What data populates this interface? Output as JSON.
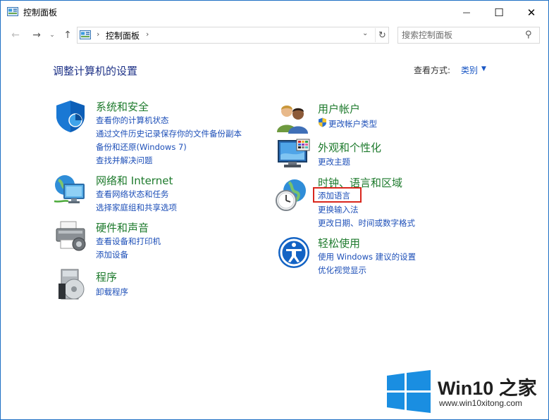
{
  "window": {
    "title": "控制面板",
    "min_glyph": "—",
    "max_glyph": "☐",
    "close_glyph": "✕"
  },
  "nav": {
    "back_glyph": "←",
    "forward_glyph": "→",
    "recent_glyph": "⌄",
    "up_glyph": "↑",
    "breadcrumb": "控制面板",
    "sep1": "›",
    "sep2": "›",
    "dropdown_glyph": "⌄",
    "refresh_glyph": "↻"
  },
  "search": {
    "placeholder": "搜索控制面板",
    "icon_glyph": "⚲"
  },
  "main": {
    "heading": "调整计算机的设置",
    "view_by_label": "查看方式:",
    "view_by_value": "类别",
    "view_by_arrow": "▼"
  },
  "categories": {
    "system_security": {
      "title": "系统和安全",
      "links": [
        "查看你的计算机状态",
        "通过文件历史记录保存你的文件备份副本",
        "备份和还原(Windows 7)",
        "查找并解决问题"
      ]
    },
    "network_internet": {
      "title": "网络和 Internet",
      "links": [
        "查看网络状态和任务",
        "选择家庭组和共享选项"
      ]
    },
    "hardware_sound": {
      "title": "硬件和声音",
      "links": [
        "查看设备和打印机",
        "添加设备"
      ]
    },
    "programs": {
      "title": "程序",
      "links": [
        "卸载程序"
      ]
    },
    "user_accounts": {
      "title": "用户帐户",
      "links": [
        "更改帐户类型"
      ]
    },
    "appearance": {
      "title": "外观和个性化",
      "links": [
        "更改主题"
      ]
    },
    "clock_region": {
      "title": "时钟、语言和区域",
      "links": [
        "添加语言",
        "更换输入法",
        "更改日期、时间或数字格式"
      ]
    },
    "ease_of_access": {
      "title": "轻松使用",
      "links": [
        "使用 Windows 建议的设置",
        "优化视觉显示"
      ]
    }
  },
  "watermark": {
    "title": "Win10 之家",
    "url": "www.win10xitong.com"
  },
  "colors": {
    "heading": "#1e3287",
    "category_title": "#1d7a2c",
    "link": "#1d4fb8",
    "highlight": "#d9261c",
    "win_blue": "#1a8ee1"
  }
}
